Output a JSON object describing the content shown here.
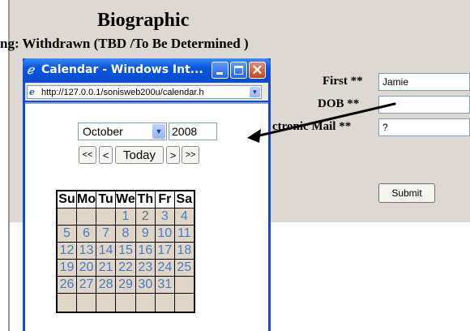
{
  "page": {
    "title": "Biographic",
    "status": "ng: Withdrawn (TBD /To Be Determined )",
    "fields": [
      {
        "label": "First **",
        "value": ""
      },
      {
        "label": "DOB **",
        "value": ""
      },
      {
        "label": "ctronic Mail **",
        "value": ""
      }
    ],
    "first_value": "Jamie",
    "dob_value": "",
    "email_value": "?",
    "submit_label": "Submit"
  },
  "popup": {
    "title": "Calendar - Windows Int...",
    "url": "http://127.0.0.1/sonisweb200u/calendar.h",
    "month": "October",
    "year": "2008",
    "nav": {
      "prev_year": "<<",
      "prev": "<",
      "today": "Today",
      "next": ">",
      "next_year": ">>"
    },
    "weekdays": [
      "Su",
      "Mo",
      "Tu",
      "We",
      "Th",
      "Fr",
      "Sa"
    ],
    "weeks": [
      [
        "",
        "",
        "",
        "1",
        "2",
        "3",
        "4"
      ],
      [
        "5",
        "6",
        "7",
        "8",
        "9",
        "10",
        "11"
      ],
      [
        "12",
        "13",
        "14",
        "15",
        "16",
        "17",
        "18"
      ],
      [
        "19",
        "20",
        "21",
        "22",
        "23",
        "24",
        "25"
      ],
      [
        "26",
        "27",
        "28",
        "29",
        "30",
        "31",
        ""
      ],
      [
        "",
        "",
        "",
        "",
        "",
        "",
        ""
      ]
    ],
    "today_day": "2"
  },
  "colors": {
    "page_background": "#ddd8d2",
    "titlebar_blue": "#0a56e0",
    "day_link": "#4a7ac8",
    "cell_background": "#e0d6c6"
  },
  "icons": {
    "window_icon": "ie-icon",
    "address_icon": "page-icon",
    "arrow": "annotation-arrow"
  }
}
